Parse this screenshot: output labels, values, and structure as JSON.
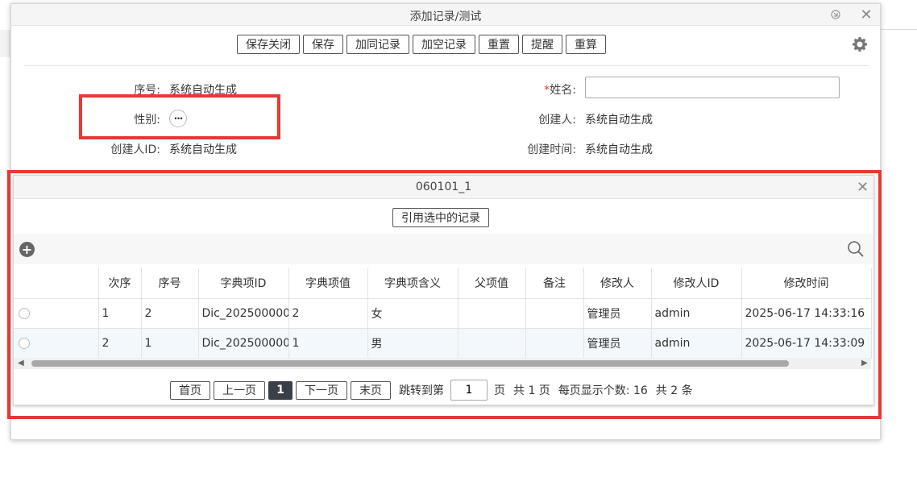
{
  "window": {
    "title": "添加记录/测试"
  },
  "toolbar": {
    "buttons": [
      "保存关闭",
      "保存",
      "加同记录",
      "加空记录",
      "重置",
      "提醒",
      "重算"
    ]
  },
  "form": {
    "seq_label": "序号:",
    "seq_value": "系统自动生成",
    "name_label": "姓名:",
    "name_required": "*",
    "name_value": "",
    "gender_label": "性别:",
    "gender_picker": "···",
    "creator_label": "创建人:",
    "creator_value": "系统自动生成",
    "creator_id_label": "创建人ID:",
    "creator_id_value": "系统自动生成",
    "create_time_label": "创建时间:",
    "create_time_value": "系统自动生成"
  },
  "subdialog": {
    "title": "060101_1",
    "ref_button": "引用选中的记录",
    "columns": [
      "次序",
      "序号",
      "字典项ID",
      "字典项值",
      "字典项含义",
      "父项值",
      "备注",
      "修改人",
      "修改人ID",
      "修改时间"
    ],
    "rows": [
      {
        "order": "1",
        "seq": "2",
        "dict_id": "Dic_2025000001_00000...",
        "value": "2",
        "meaning": "女",
        "parent": "",
        "remark": "",
        "modifier": "管理员",
        "modifier_id": "admin",
        "modified_time": "2025-06-17 14:33:16"
      },
      {
        "order": "2",
        "seq": "1",
        "dict_id": "Dic_2025000001_00000...",
        "value": "1",
        "meaning": "男",
        "parent": "",
        "remark": "",
        "modifier": "管理员",
        "modifier_id": "admin",
        "modified_time": "2025-06-17 14:33:09"
      }
    ],
    "pager": {
      "first": "首页",
      "prev": "上一页",
      "current": "1",
      "next": "下一页",
      "last": "末页",
      "jump_label": "跳转到第",
      "jump_value": "1",
      "page_unit": "页",
      "total_pages": "共 1 页",
      "per_page": "每页显示个数: 16",
      "total_records": "共 2 条"
    }
  },
  "colors": {
    "highlight": "#e53935",
    "current_page": "#3a4048",
    "alt_row": "#f3f8fc"
  }
}
